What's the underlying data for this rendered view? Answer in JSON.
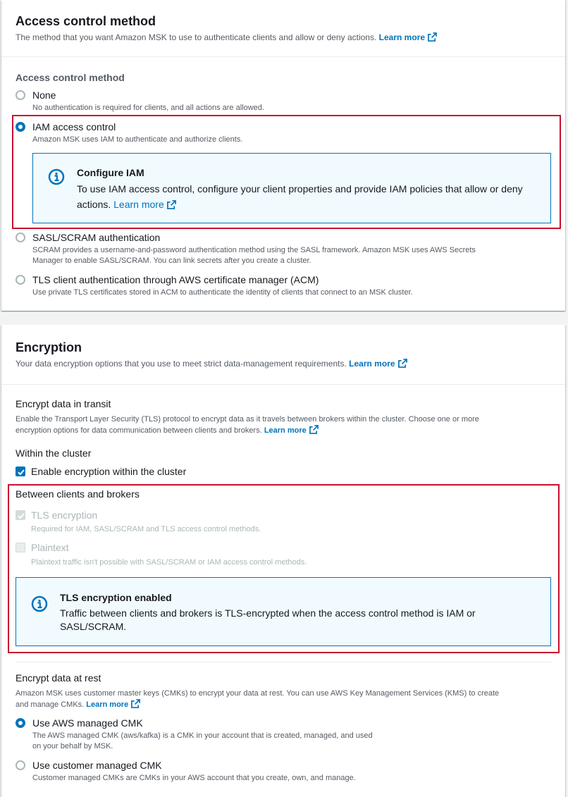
{
  "access": {
    "title": "Access control method",
    "description": "The method that you want Amazon MSK to use to authenticate clients and allow or deny actions.",
    "learn_more": "Learn more",
    "field_label": "Access control method",
    "options": [
      {
        "label": "None",
        "description": "No authentication is required for clients, and all actions are allowed.",
        "selected": false
      },
      {
        "label": "IAM access control",
        "description": "Amazon MSK uses IAM to authenticate and authorize clients.",
        "selected": true
      },
      {
        "label": "SASL/SCRAM authentication",
        "description_line1": "SCRAM provides a username-and-password authentication method using the SASL framework. Amazon MSK uses AWS Secrets",
        "description_line2": "Manager to enable SASL/SCRAM. You can link secrets after you create a cluster.",
        "selected": false
      },
      {
        "label": "TLS client authentication through AWS certificate manager (ACM)",
        "description": "Use private TLS certificates stored in ACM to authenticate the identity of clients that connect to an MSK cluster.",
        "selected": false
      }
    ],
    "info": {
      "title": "Configure IAM",
      "text_line1": "To use IAM access control, configure your client properties and provide IAM policies that allow or deny",
      "text_line2": "actions.",
      "learn_more": "Learn more"
    }
  },
  "encryption": {
    "title": "Encryption",
    "description": "Your data encryption options that you use to meet strict data-management requirements.",
    "learn_more": "Learn more",
    "transit": {
      "title": "Encrypt data in transit",
      "desc_line1": "Enable the Transport Layer Security (TLS) protocol to encrypt data as it travels between brokers within the cluster. Choose one or more",
      "desc_line2": "encryption options for data communication between clients and brokers.",
      "learn_more": "Learn more",
      "within_label": "Within the cluster",
      "within_checkbox": "Enable encryption within the cluster",
      "between_label": "Between clients and brokers",
      "tls_label": "TLS encryption",
      "tls_desc": "Required for IAM, SASL/SCRAM and TLS access control methods.",
      "plaintext_label": "Plaintext",
      "plaintext_desc": "Plaintext traffic isn't possible with SASL/SCRAM or IAM access control methods.",
      "info": {
        "title": "TLS encryption enabled",
        "text_line1": "Traffic between clients and brokers is TLS-encrypted when the access control method is IAM or",
        "text_line2": "SASL/SCRAM."
      }
    },
    "rest": {
      "title": "Encrypt data at rest",
      "desc_line1": "Amazon MSK uses customer master keys (CMKs) to encrypt your data at rest. You can use AWS Key Management Services (KMS) to create",
      "desc_line2": "and manage CMKs.",
      "learn_more": "Learn more",
      "options": [
        {
          "label": "Use AWS managed CMK",
          "desc_line1": "The AWS managed CMK (aws/kafka) is a CMK in your account that is created, managed, and used",
          "desc_line2": "on your behalf by MSK.",
          "selected": true
        },
        {
          "label": "Use customer managed CMK",
          "desc_line1": "Customer managed CMKs are CMKs in your AWS account that you create, own, and manage.",
          "selected": false
        }
      ]
    }
  },
  "colors": {
    "accent": "#0073bb",
    "highlight_border": "#c8102e",
    "info_bg": "#f1faff"
  },
  "icons": [
    "external-link-icon",
    "info-icon",
    "checkmark-icon"
  ]
}
